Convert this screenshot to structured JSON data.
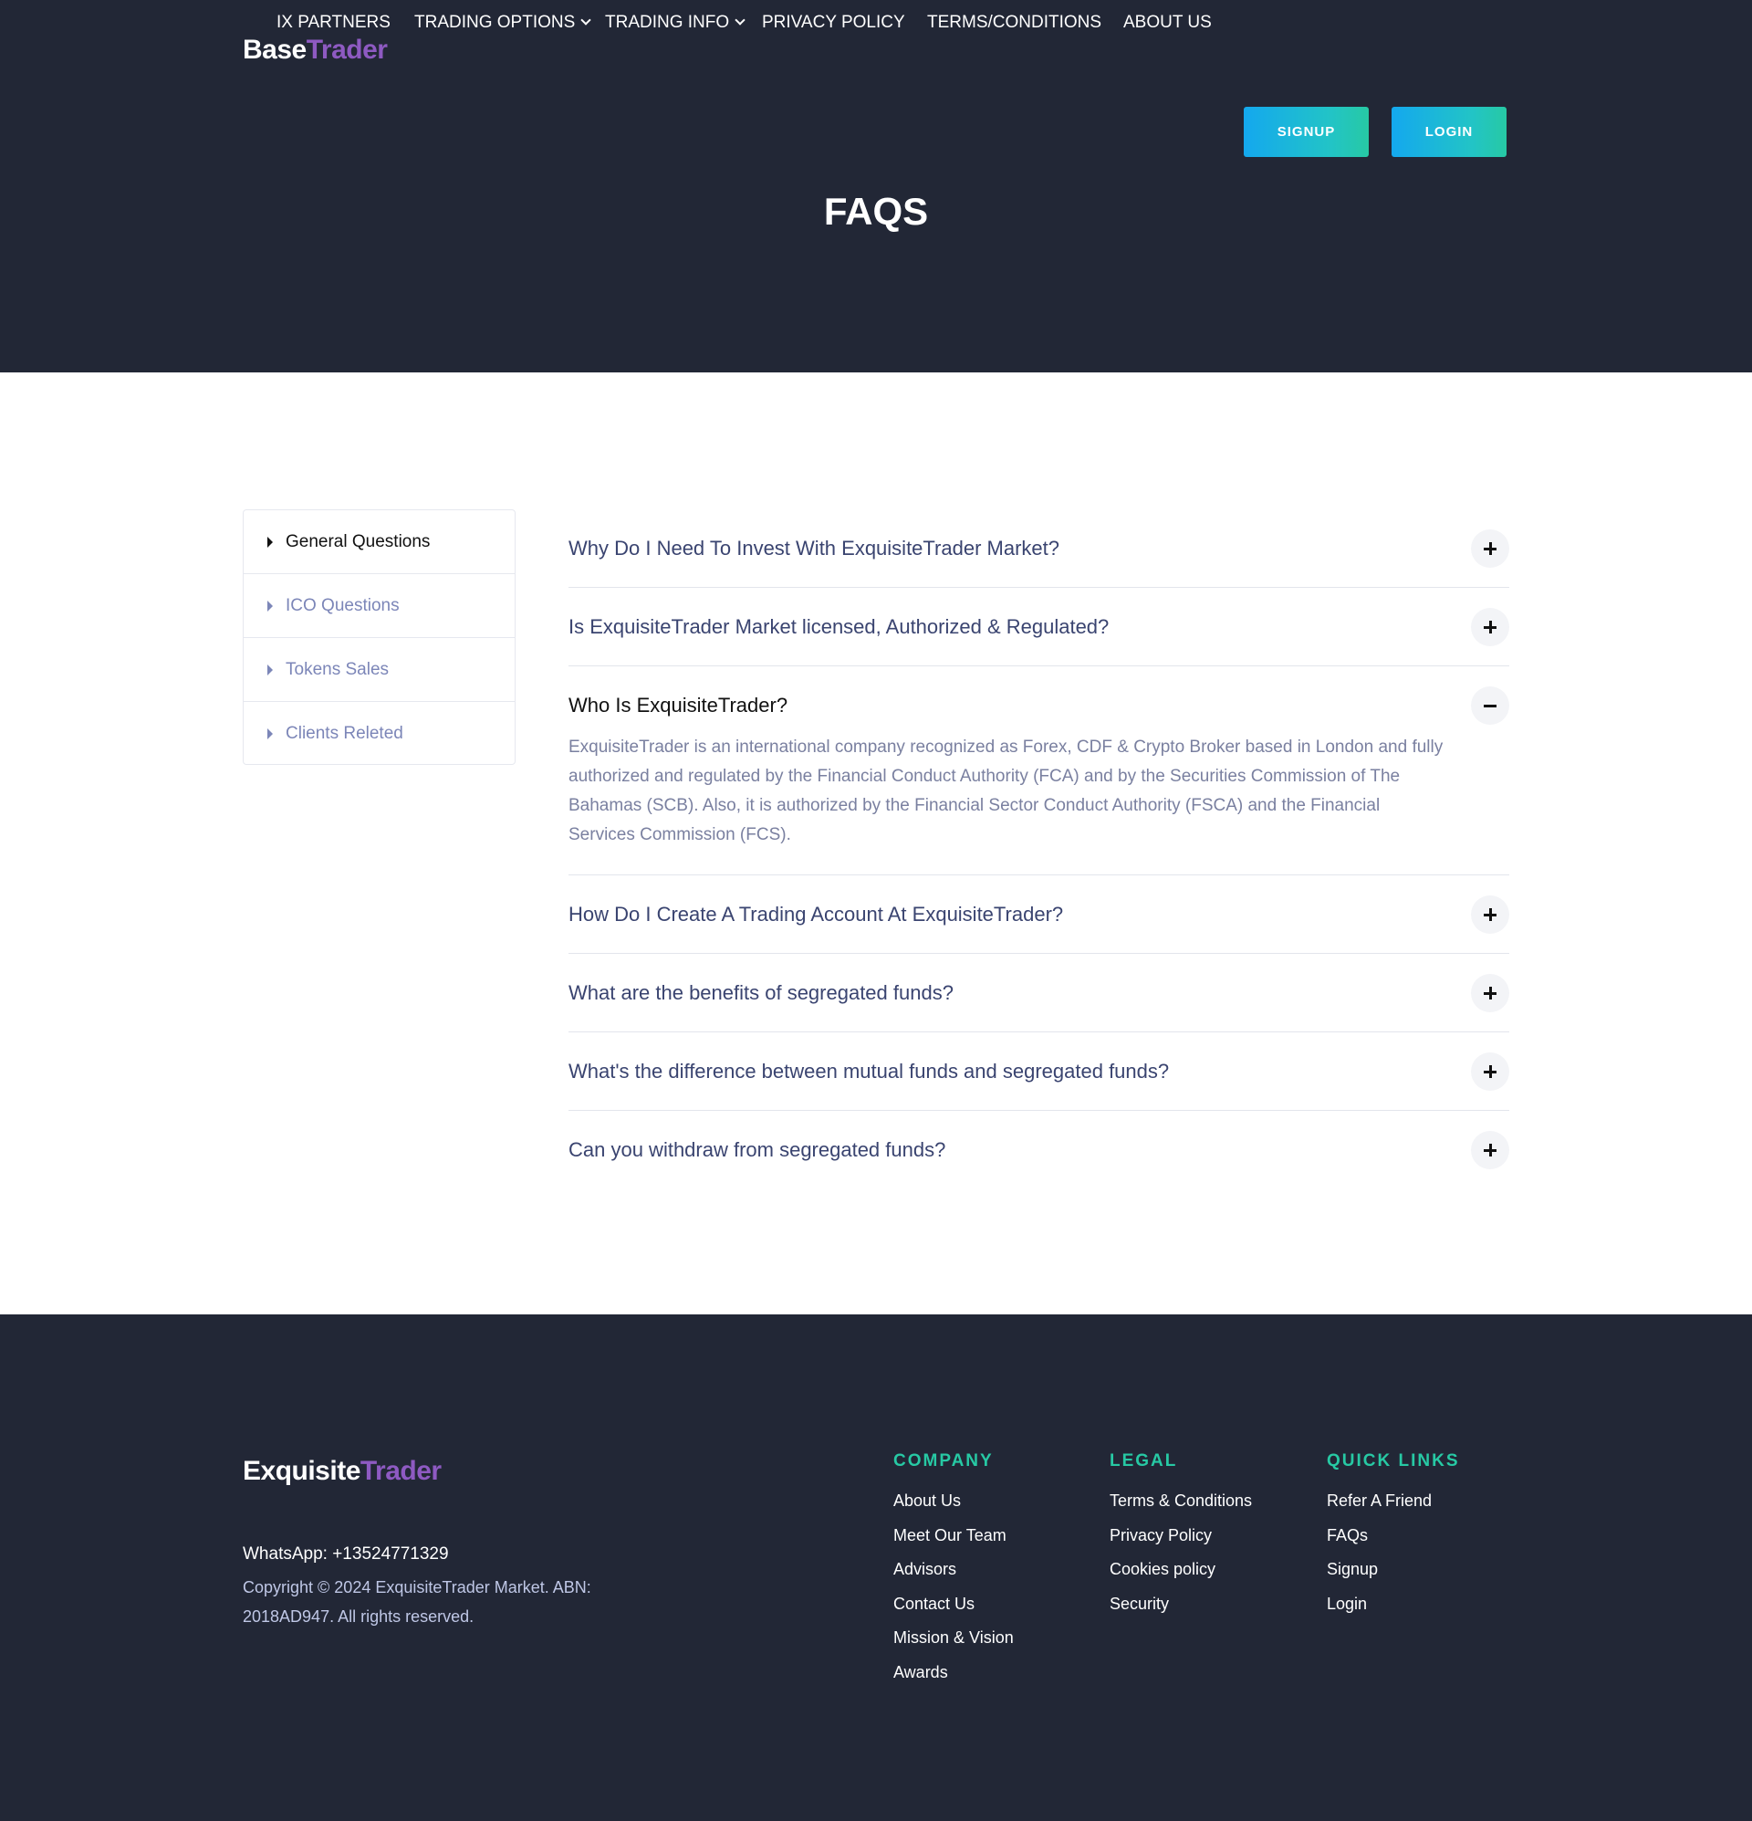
{
  "header": {
    "logo_part1": "Base",
    "logo_part2": "Trader",
    "nav": [
      {
        "label": "IX PARTNERS",
        "dropdown": false
      },
      {
        "label": "TRADING OPTIONS",
        "dropdown": true
      },
      {
        "label": "TRADING INFO",
        "dropdown": true
      },
      {
        "label": "PRIVACY POLICY",
        "dropdown": false
      },
      {
        "label": "TERMS/CONDITIONS",
        "dropdown": false
      },
      {
        "label": "ABOUT US",
        "dropdown": false
      }
    ],
    "signup_label": "SIGNUP",
    "login_label": "LOGIN",
    "page_title": "FAQS"
  },
  "sidebar": {
    "items": [
      {
        "label": "General Questions",
        "active": true
      },
      {
        "label": "ICO Questions",
        "active": false
      },
      {
        "label": "Tokens Sales",
        "active": false
      },
      {
        "label": "Clients Releted",
        "active": false
      }
    ]
  },
  "faq": {
    "items": [
      {
        "question": "Why Do I Need To Invest With ExquisiteTrader Market?",
        "open": false
      },
      {
        "question": "Is ExquisiteTrader Market licensed, Authorized & Regulated?",
        "open": false
      },
      {
        "question": "Who Is ExquisiteTrader?",
        "open": true,
        "answer": "ExquisiteTrader is an international company recognized as Forex, CDF & Crypto Broker based in London and fully authorized and regulated by the Financial Conduct Authority (FCA) and by the Securities Commission of The Bahamas (SCB). Also, it is authorized by the Financial Sector Conduct Authority (FSCA) and the Financial Services Commission (FCS)."
      },
      {
        "question": "How Do I Create A Trading Account At ExquisiteTrader?",
        "open": false
      },
      {
        "question": "What are the benefits of segregated funds?",
        "open": false
      },
      {
        "question": "What's the difference between mutual funds and segregated funds?",
        "open": false
      },
      {
        "question": "Can you withdraw from segregated funds?",
        "open": false
      }
    ]
  },
  "footer": {
    "logo_part1": "Exquisite",
    "logo_part2": "Trader",
    "whatsapp": "WhatsApp: +13524771329",
    "copyright": "Copyright © 2024 ExquisiteTrader Market. ABN: 2018AD947. All rights reserved.",
    "columns": [
      {
        "title": "COMPANY",
        "links": [
          "About Us",
          "Meet Our Team",
          "Advisors",
          "Contact Us",
          "Mission & Vision",
          "Awards"
        ]
      },
      {
        "title": "LEGAL",
        "links": [
          "Terms & Conditions",
          "Privacy Policy",
          "Cookies policy",
          "Security"
        ]
      },
      {
        "title": "QUICK LINKS",
        "links": [
          "Refer A Friend",
          "FAQs",
          "Signup",
          "Login"
        ]
      }
    ]
  },
  "colors": {
    "dark_bg": "#222736",
    "accent_purple": "#8e5ac2",
    "accent_teal": "#27c9a4",
    "accent_blue": "#14a8ee"
  }
}
